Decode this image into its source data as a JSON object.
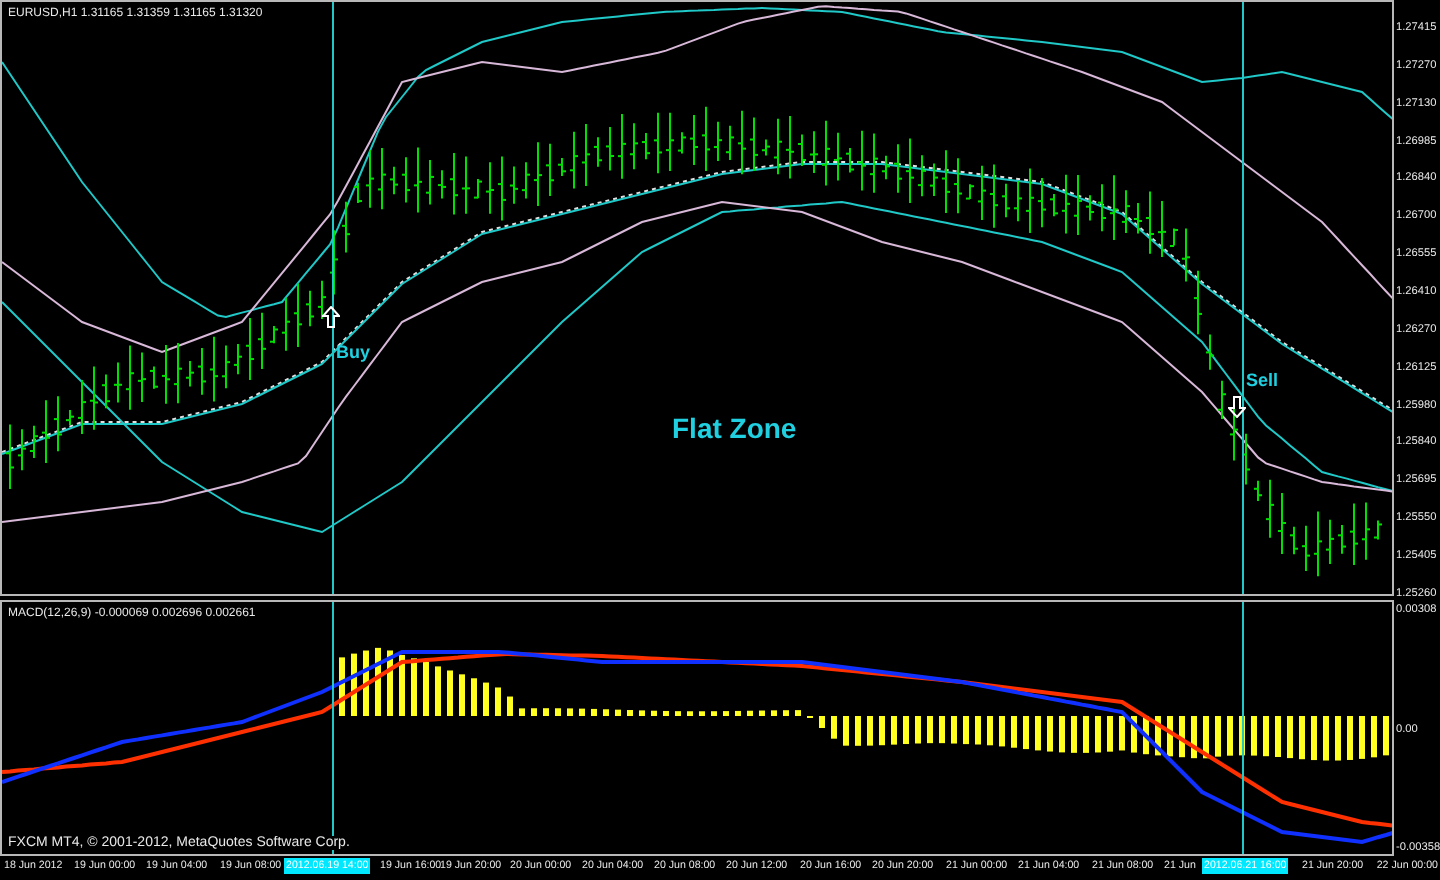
{
  "main_chart": {
    "title": "EURUSD,H1  1.31165 1.31359 1.31165 1.31320",
    "annotations": [
      {
        "kind": "buy",
        "text": "Buy"
      },
      {
        "kind": "sell",
        "text": "Sell"
      },
      {
        "kind": "zone",
        "text": "Flat Zone"
      }
    ],
    "price_axis": [
      "1.27415",
      "1.27270",
      "1.27130",
      "1.26985",
      "1.26840",
      "1.26700",
      "1.26555",
      "1.26410",
      "1.26270",
      "1.26125",
      "1.25980",
      "1.25840",
      "1.25695",
      "1.25550",
      "1.25405",
      "1.25260"
    ]
  },
  "macd_chart": {
    "title": "MACD(12,26,9) -0.000069 0.002696 0.002661",
    "axis": [
      "0.00308",
      "0.00",
      "-0.00358"
    ]
  },
  "copyright": "FXCM MT4, © 2001-2012, MetaQuotes Software Corp.",
  "time_axis": [
    "18 Jun 2012",
    "19 Jun 00:00",
    "19 Jun 04:00",
    "19 Jun 08:00",
    "19 Jun 16:00",
    "19 Jun 20:00",
    "20 Jun 00:00",
    "20 Jun 04:00",
    "20 Jun 08:00",
    "20 Jun 12:00",
    "20 Jun 16:00",
    "20 Jun 20:00",
    "21 Jun 00:00",
    "21 Jun 04:00",
    "21 Jun 08:00",
    "21 Jun",
    "21 Jun 20:00",
    "22 Jun 00:00"
  ],
  "crosshair_labels": [
    "2012.06.19 14:00",
    "2012.06.21 16:00"
  ]
}
